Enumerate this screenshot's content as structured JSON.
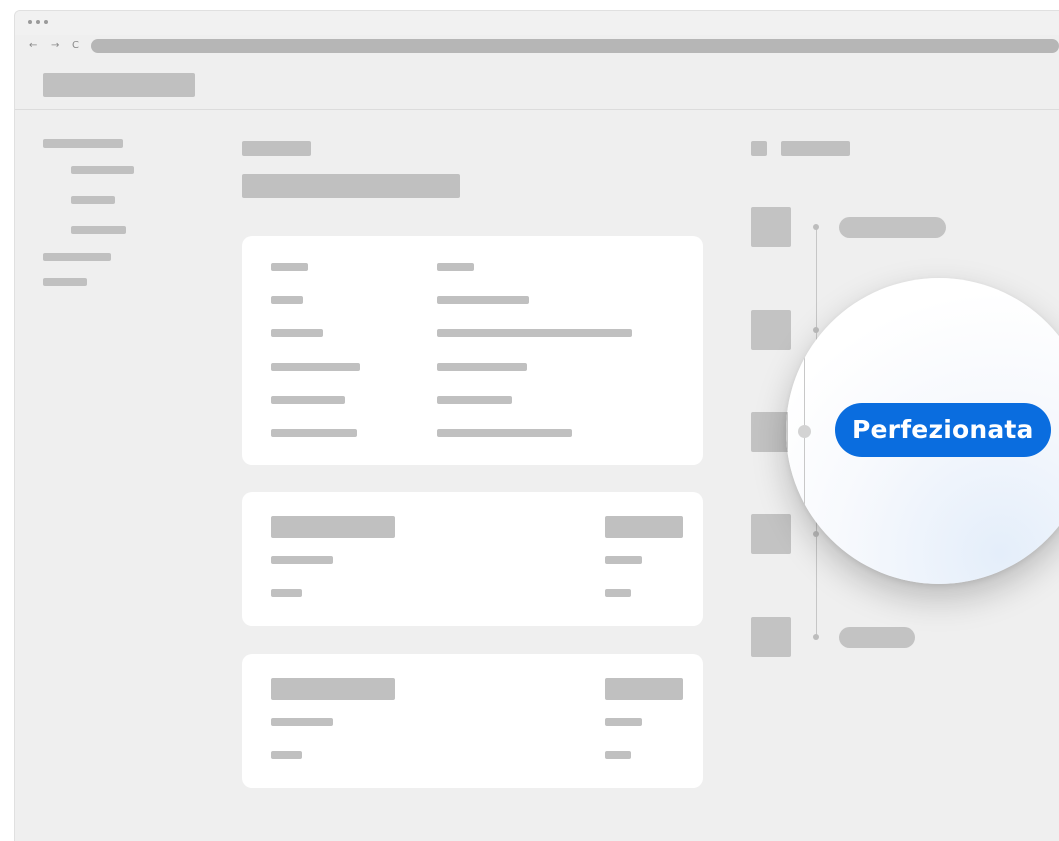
{
  "browser": {
    "nav": {
      "back_icon": "←",
      "forward_icon": "→",
      "reload_icon": "C"
    }
  },
  "timeline": {
    "status_badge": {
      "label": "Perfezionata",
      "color": "#0a6ddf"
    }
  },
  "colors": {
    "page_background": "#efefef",
    "card_background": "#ffffff",
    "placeholder": "#c0c0c0"
  }
}
